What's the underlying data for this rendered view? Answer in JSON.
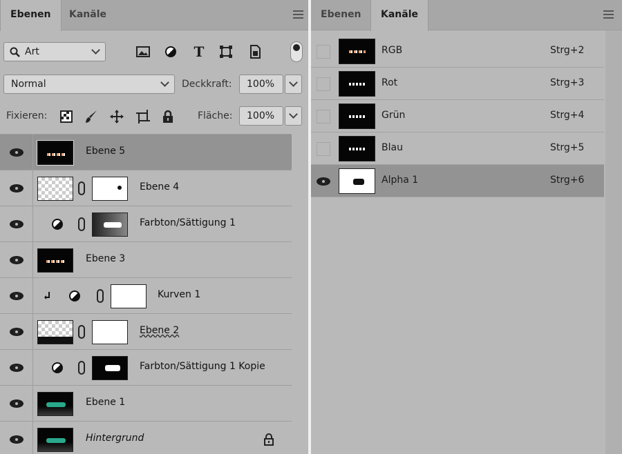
{
  "left": {
    "tabs": [
      {
        "label": "Ebenen",
        "active": true
      },
      {
        "label": "Kanäle",
        "active": false
      }
    ],
    "filter": {
      "label": "Art",
      "icon": "search-icon"
    },
    "filter_tools": [
      "image-filter-icon",
      "adjustment-filter-icon",
      "type-filter-icon",
      "shape-filter-icon",
      "smart-object-filter-icon",
      "filter-toggle-icon"
    ],
    "blend_mode": "Normal",
    "opacity": {
      "label": "Deckkraft:",
      "value": "100%"
    },
    "lock": {
      "label": "Fixieren:",
      "icons": [
        "lock-transparent-icon",
        "lock-pixels-icon",
        "lock-position-icon",
        "lock-artboard-icon",
        "lock-all-icon"
      ]
    },
    "fill": {
      "label": "Fläche:",
      "value": "100%"
    },
    "layers": [
      {
        "name": "Ebene 5",
        "selected": true,
        "type": "pixel"
      },
      {
        "name": "Ebene 4",
        "type": "masked"
      },
      {
        "name": "Farbton/Sättigung 1",
        "type": "adjustment"
      },
      {
        "name": "Ebene 3",
        "type": "pixel"
      },
      {
        "name": "Kurven 1",
        "type": "adjustment-clipped"
      },
      {
        "name": "Ebene 2",
        "type": "masked"
      },
      {
        "name": "Farbton/Sättigung 1 Kopie",
        "type": "adjustment"
      },
      {
        "name": "Ebene 1",
        "type": "pixel"
      },
      {
        "name": "Hintergrund",
        "type": "background",
        "locked": true
      }
    ]
  },
  "right": {
    "tabs": [
      {
        "label": "Ebenen",
        "active": false
      },
      {
        "label": "Kanäle",
        "active": true
      }
    ],
    "channels": [
      {
        "name": "RGB",
        "shortcut": "Strg+2"
      },
      {
        "name": "Rot",
        "shortcut": "Strg+3"
      },
      {
        "name": "Grün",
        "shortcut": "Strg+4"
      },
      {
        "name": "Blau",
        "shortcut": "Strg+5"
      },
      {
        "name": "Alpha 1",
        "shortcut": "Strg+6",
        "selected": true,
        "visible": true
      }
    ]
  },
  "colors": {
    "panel": "#b9b9b9",
    "selected_row": "#939393",
    "tabbar": "#a7a7a7"
  }
}
